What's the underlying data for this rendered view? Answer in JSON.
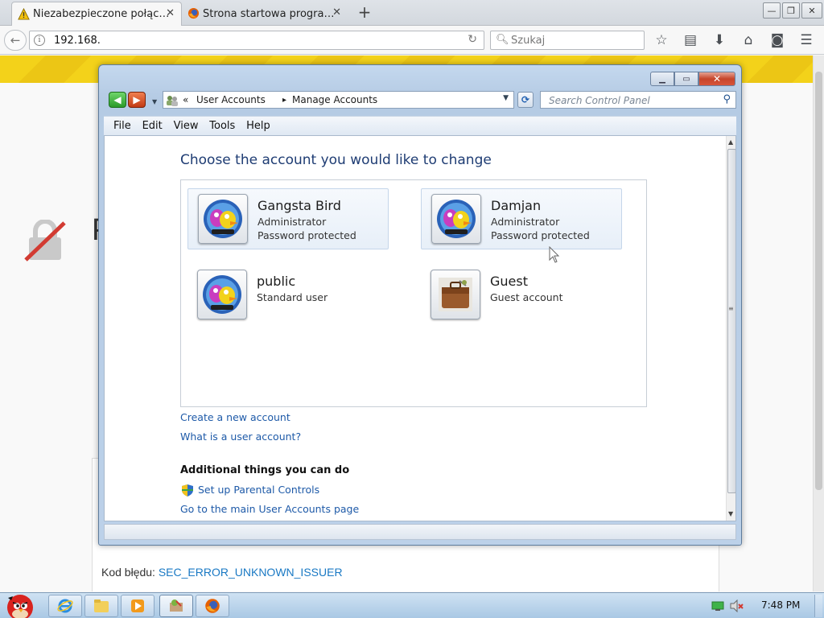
{
  "firefox": {
    "tabs": [
      {
        "title": "Niezabezpieczone połąc…",
        "active": true
      },
      {
        "title": "Strona startowa progra…",
        "active": false
      }
    ],
    "url": "192.168.",
    "search_placeholder": "Szukaj"
  },
  "background_page": {
    "heading_fragment": "P",
    "error_label": "Kod błędu:",
    "error_code": "SEC_ERROR_UNKNOWN_ISSUER"
  },
  "dialog": {
    "breadcrumb": {
      "prefix": "«",
      "items": [
        "User Accounts",
        "Manage Accounts"
      ],
      "separator": "▸"
    },
    "search_placeholder": "Search Control Panel",
    "menu": [
      "File",
      "Edit",
      "View",
      "Tools",
      "Help"
    ],
    "title": "Choose the account you would like to change",
    "accounts": [
      {
        "name": "Gangsta Bird",
        "type": "Administrator",
        "status": "Password protected",
        "picture": "bird-avatar"
      },
      {
        "name": "Damjan",
        "type": "Administrator",
        "status": "Password protected",
        "picture": "bird-avatar"
      },
      {
        "name": "public",
        "type": "Standard user",
        "status": "",
        "picture": "bird-avatar"
      },
      {
        "name": "Guest",
        "type": "Guest account",
        "status": "",
        "picture": "briefcase"
      }
    ],
    "links": {
      "create": "Create a new account",
      "what_is": "What is a user account?",
      "additional_heading": "Additional things you can do",
      "parental": "Set up Parental Controls",
      "main_page": "Go to the main User Accounts page"
    }
  },
  "taskbar": {
    "clock": "7:48 PM"
  },
  "colors": {
    "link": "#1e5aa8",
    "title": "#1e3c73",
    "close_button": "#c6452b"
  }
}
